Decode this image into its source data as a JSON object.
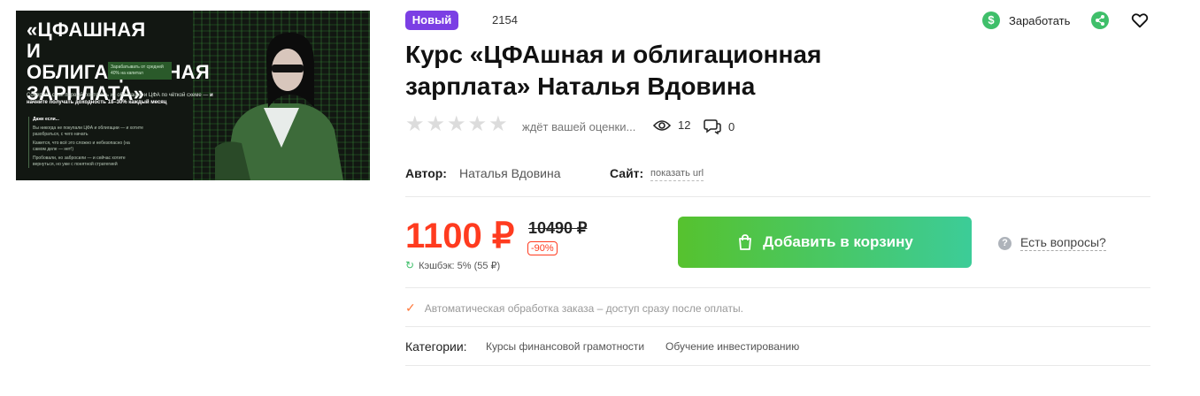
{
  "banner": {
    "title_line1": "«ЦФАШНАЯ",
    "title_line2": "И ОБЛИГАЦИОННАЯ",
    "title_line3": "ЗАРПЛАТА»",
    "badge_text": "Зарабатывать от средней 40% на капитал",
    "subtitle": "Соберите свой первый портфель из облигаций и ЦФА по чёткой схеме —",
    "subtitle_bold": "и начните получать доходность 18–30% каждый месяц",
    "list_heading": "Даже если...",
    "list_items": [
      "Вы никогда не покупали ЦФА и облигации — и хотите разобраться, с чего начать",
      "Кажется, что всё это сложно и небезопасно (на самом деле — нет!)",
      "Пробовали, но забросили — и сейчас хотите вернуться, но уже с понятной стратегией"
    ]
  },
  "tag_new": "Новый",
  "counter": "2154",
  "earn_label": "Заработать",
  "title": "Курс «ЦФАшная и облигационная зарплата» Наталья Вдовина",
  "rating": {
    "stars": 5,
    "text": "ждёт вашей оценки...",
    "views": "12",
    "comments": "0"
  },
  "author": {
    "label": "Автор:",
    "name": "Наталья Вдовина"
  },
  "site": {
    "label": "Сайт:",
    "link": "показать url"
  },
  "price": {
    "current": "1100 ₽",
    "old": "10490 ₽",
    "discount": "-90%",
    "cashback": "Кэшбэк: 5% (55 ₽)"
  },
  "cart_button": "Добавить в корзину",
  "questions": "Есть вопросы?",
  "auto_note": "Автоматическая обработка заказа – доступ сразу после оплаты.",
  "categories": {
    "label": "Категории:",
    "items": [
      "Курсы финансовой грамотности",
      "Обучение инвестированию"
    ]
  },
  "colors": {
    "accent_purple": "#7b3fe4",
    "price_red": "#ff3b1f",
    "green": "#3fbf6a"
  }
}
